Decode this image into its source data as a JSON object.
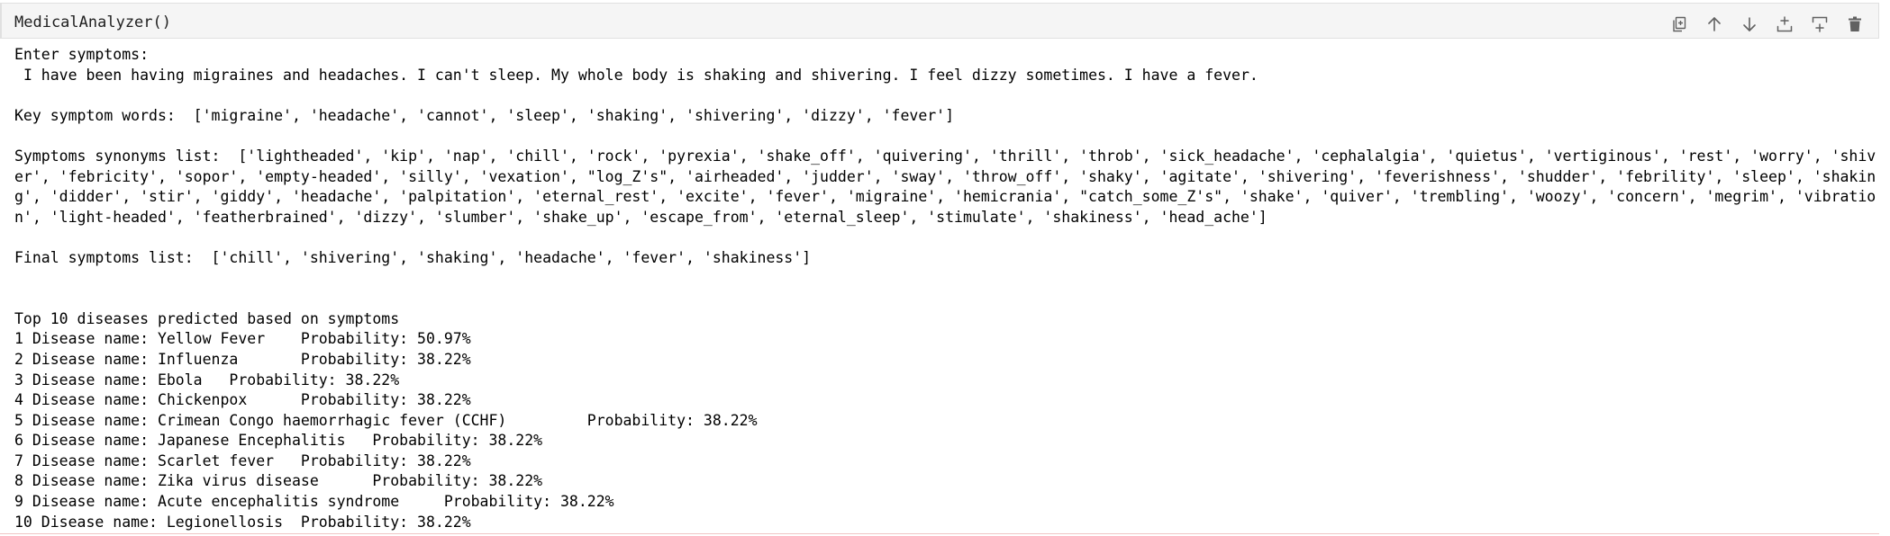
{
  "cell": {
    "code": "MedicalAnalyzer()"
  },
  "toolbar": {
    "icons": [
      "duplicate-icon",
      "move-up-icon",
      "move-down-icon",
      "insert-above-icon",
      "insert-below-icon",
      "delete-icon"
    ]
  },
  "output": {
    "prompt_label": "Enter symptoms:",
    "symptoms_input": " I have been having migraines and headaches. I can't sleep. My whole body is shaking and shivering. I feel dizzy sometimes. I have a fever.",
    "key_words_line": "Key symptom words:  ['migraine', 'headache', 'cannot', 'sleep', 'shaking', 'shivering', 'dizzy', 'fever']",
    "synonyms_line": "Symptoms synonyms list:  ['lightheaded', 'kip', 'nap', 'chill', 'rock', 'pyrexia', 'shake_off', 'quivering', 'thrill', 'throb', 'sick_headache', 'cephalalgia', 'quietus', 'vertiginous', 'rest', 'worry', 'shiver', 'febricity', 'sopor', 'empty-headed', 'silly', 'vexation', \"log_Z's\", 'airheaded', 'judder', 'sway', 'throw_off', 'shaky', 'agitate', 'shivering', 'feverishness', 'shudder', 'febrility', 'sleep', 'shaking', 'didder', 'stir', 'giddy', 'headache', 'palpitation', 'eternal_rest', 'excite', 'fever', 'migraine', 'hemicrania', \"catch_some_Z's\", 'shake', 'quiver', 'trembling', 'woozy', 'concern', 'megrim', 'vibration', 'light-headed', 'featherbrained', 'dizzy', 'slumber', 'shake_up', 'escape_from', 'eternal_sleep', 'stimulate', 'shakiness', 'head_ache']",
    "final_line": "Final symptoms list:  ['chill', 'shivering', 'shaking', 'headache', 'fever', 'shakiness']",
    "top_heading": "Top 10 diseases predicted based on symptoms",
    "diseases": [
      "1 Disease name: Yellow Fever    Probability: 50.97%",
      "2 Disease name: Influenza       Probability: 38.22%",
      "3 Disease name: Ebola   Probability: 38.22%",
      "4 Disease name: Chickenpox      Probability: 38.22%",
      "5 Disease name: Crimean Congo haemorrhagic fever (CCHF)         Probability: 38.22%",
      "6 Disease name: Japanese Encephalitis   Probability: 38.22%",
      "7 Disease name: Scarlet fever   Probability: 38.22%",
      "8 Disease name: Zika virus disease      Probability: 38.22%",
      "9 Disease name: Acute encephalitis syndrome     Probability: 38.22%",
      "10 Disease name: Legionellosis  Probability: 38.22%"
    ]
  }
}
